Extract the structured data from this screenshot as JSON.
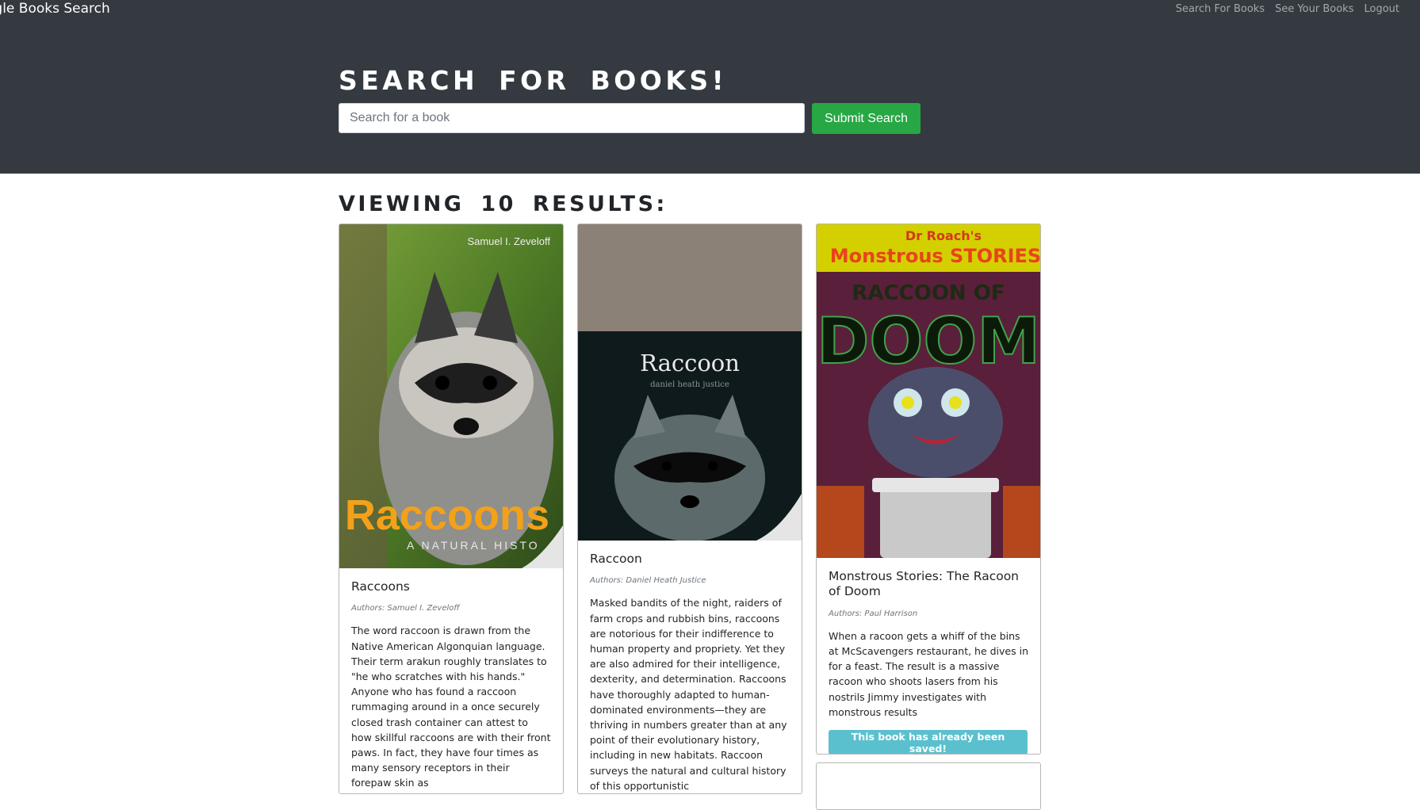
{
  "navbar": {
    "brand": "ogle Books Search",
    "links": [
      "Search For Books",
      "See Your Books",
      "Logout"
    ]
  },
  "hero": {
    "title": "Search For Books!",
    "search_placeholder": "Search for a book",
    "submit_label": "Submit Search"
  },
  "results": {
    "heading": "Viewing 10 results:",
    "books": [
      {
        "title": "Raccoons",
        "authors": "Authors: Samuel I. Zeveloff",
        "cover_text": [
          "Samuel I. Zeveloff",
          "Raccoons",
          "A NATURAL HISTO"
        ],
        "description": "The word raccoon is drawn from the Native American Algonquian language. Their term arakun roughly translates to \"he who scratches with his hands.\" Anyone who has found a raccoon rummaging around in a once securely closed trash container can attest to how skillful raccoons are with their front paws. In fact, they have four times as many sensory receptors in their forepaw skin as"
      },
      {
        "title": "Raccoon",
        "authors": "Authors: Daniel Heath Justice",
        "cover_text": [
          "Raccoon",
          "daniel heath justice"
        ],
        "description": "Masked bandits of the night, raiders of farm crops and rubbish bins, raccoons are notorious for their indifference to human property and propriety. Yet they are also admired for their intelligence, dexterity, and determination. Raccoons have thoroughly adapted to human-dominated environments—they are thriving in numbers greater than at any point of their evolutionary history, including in new habitats. Raccoon surveys the natural and cultural history of this opportunistic"
      },
      {
        "title": "Monstrous Stories: The Racoon of Doom",
        "authors": "Authors: Paul Harrison",
        "cover_text": [
          "Dr Roach's",
          "Monstrous STORIES",
          "RACCOON OF",
          "DOOM"
        ],
        "description": "When a racoon gets a whiff of the bins at McScavengers restaurant, he dives in for a feast. The result is a massive racoon who shoots lasers from his nostrils Jimmy investigates with monstrous results",
        "saved_label": "This book has already been saved!"
      }
    ]
  }
}
